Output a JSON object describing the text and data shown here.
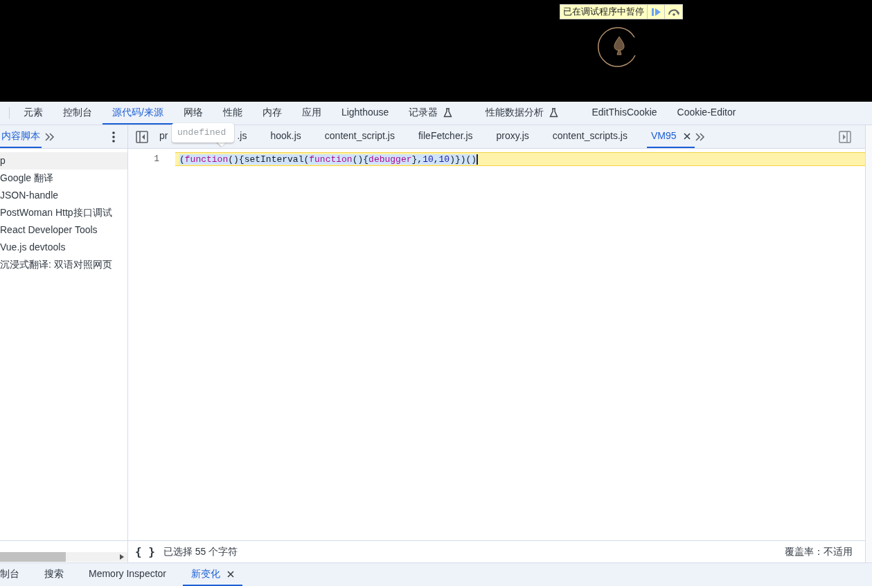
{
  "pause_banner": {
    "text": "已在调试程序中暂停"
  },
  "main_tabs": [
    {
      "label": "元素",
      "selected": false,
      "experimental": false
    },
    {
      "label": "控制台",
      "selected": false,
      "experimental": false
    },
    {
      "label": "源代码/来源",
      "selected": true,
      "experimental": false
    },
    {
      "label": "网络",
      "selected": false,
      "experimental": false
    },
    {
      "label": "性能",
      "selected": false,
      "experimental": false
    },
    {
      "label": "内存",
      "selected": false,
      "experimental": false
    },
    {
      "label": "应用",
      "selected": false,
      "experimental": false
    },
    {
      "label": "Lighthouse",
      "selected": false,
      "experimental": false
    },
    {
      "label": "记录器",
      "selected": false,
      "experimental": true
    },
    {
      "label": "性能数据分析",
      "selected": false,
      "experimental": true
    },
    {
      "label": "EditThisCookie",
      "selected": false,
      "experimental": false
    },
    {
      "label": "Cookie-Editor",
      "selected": false,
      "experimental": false
    }
  ],
  "navigator": {
    "tab": "内容脚本",
    "items": [
      {
        "label": "p",
        "selected": true
      },
      {
        "label": "Google 翻译",
        "selected": false
      },
      {
        "label": "JSON-handle",
        "selected": false
      },
      {
        "label": "PostWoman Http接口调试",
        "selected": false
      },
      {
        "label": "React Developer Tools",
        "selected": false
      },
      {
        "label": "Vue.js devtools",
        "selected": false
      },
      {
        "label": "沉浸式翻译: 双语对照网页",
        "selected": false
      }
    ]
  },
  "editor_tabs": [
    {
      "label": "pr",
      "label_end": ".js",
      "selected": false
    },
    {
      "label": "hook.js",
      "selected": false
    },
    {
      "label": "content_script.js",
      "selected": false
    },
    {
      "label": "fileFetcher.js",
      "selected": false
    },
    {
      "label": "proxy.js",
      "selected": false
    },
    {
      "label": "content_scripts.js",
      "selected": false
    },
    {
      "label": "VM95",
      "selected": true
    }
  ],
  "tooltip": {
    "text": "undefined"
  },
  "code": {
    "line_number": "1",
    "tokens": [
      {
        "text": "(",
        "kind": "punct"
      },
      {
        "text": "function",
        "kind": "keyword"
      },
      {
        "text": "(){setInterval(",
        "kind": "punct"
      },
      {
        "text": "function",
        "kind": "keyword"
      },
      {
        "text": "(){",
        "kind": "punct"
      },
      {
        "text": "debugger",
        "kind": "keyword"
      },
      {
        "text": "},",
        "kind": "punct"
      },
      {
        "text": "10",
        "kind": "number"
      },
      {
        "text": ",",
        "kind": "punct"
      },
      {
        "text": "10",
        "kind": "number"
      },
      {
        "text": ")})()",
        "kind": "punct"
      }
    ]
  },
  "status_bar": {
    "format_button": "{ }",
    "selection": "已选择 55 个字符",
    "coverage": "覆盖率：不适用"
  },
  "drawer_tabs": [
    {
      "label": "制台",
      "selected": false,
      "closable": false
    },
    {
      "label": "搜索",
      "selected": false,
      "closable": false
    },
    {
      "label": "Memory Inspector",
      "selected": false,
      "closable": false
    },
    {
      "label": "新变化",
      "selected": true,
      "closable": true
    }
  ]
}
